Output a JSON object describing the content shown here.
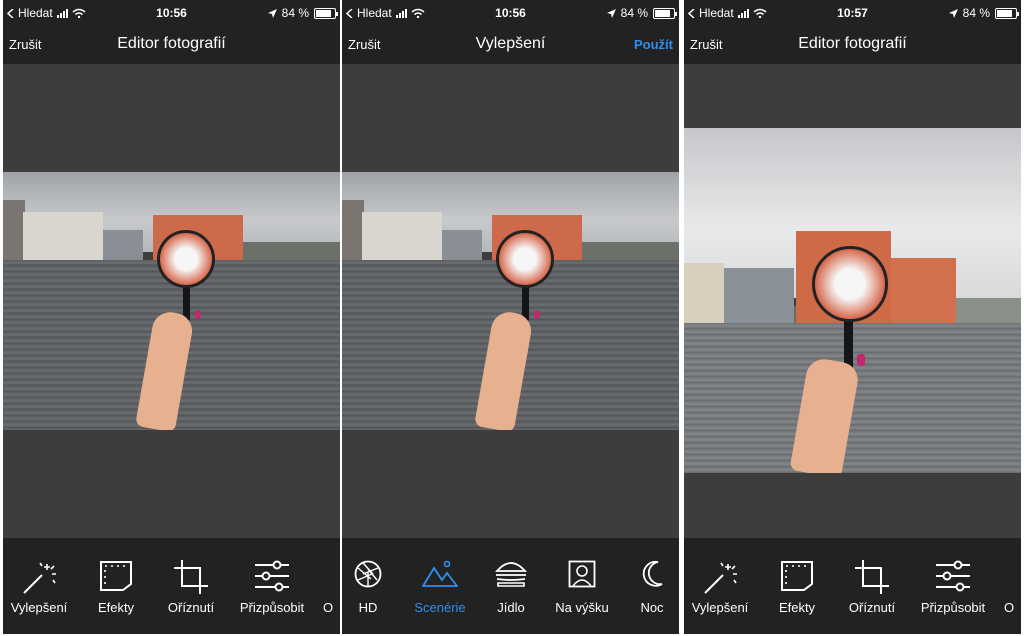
{
  "screens": [
    {
      "status": {
        "carrier": "Hledat",
        "time": "10:56",
        "battery": "84 %"
      },
      "nav": {
        "left": "Zrušit",
        "title": "Editor fotografií",
        "right": ""
      },
      "tools": [
        {
          "icon": "magic-wand-icon",
          "label": "Vylepšení"
        },
        {
          "icon": "film-frame-icon",
          "label": "Efekty"
        },
        {
          "icon": "crop-icon",
          "label": "Oříznutí"
        },
        {
          "icon": "sliders-icon",
          "label": "Přizpůsobit"
        },
        {
          "icon": "",
          "label": "O"
        }
      ]
    },
    {
      "status": {
        "carrier": "Hledat",
        "time": "10:56",
        "battery": "84 %"
      },
      "nav": {
        "left": "Zrušit",
        "title": "Vylepšení",
        "right": "Použít"
      },
      "tools": [
        {
          "icon": "aperture-icon",
          "label": "HD"
        },
        {
          "icon": "mountains-icon",
          "label": "Scenérie",
          "active": true
        },
        {
          "icon": "burger-icon",
          "label": "Jídlo"
        },
        {
          "icon": "portrait-icon",
          "label": "Na výšku"
        },
        {
          "icon": "moon-icon",
          "label": "Noc"
        }
      ]
    },
    {
      "status": {
        "carrier": "Hledat",
        "time": "10:57",
        "battery": "84 %"
      },
      "nav": {
        "left": "Zrušit",
        "title": "Editor fotografií",
        "right": ""
      },
      "tools": [
        {
          "icon": "magic-wand-icon",
          "label": "Vylepšení"
        },
        {
          "icon": "film-frame-icon",
          "label": "Efekty"
        },
        {
          "icon": "crop-icon",
          "label": "Oříznutí"
        },
        {
          "icon": "sliders-icon",
          "label": "Přizpůsobit"
        },
        {
          "icon": "",
          "label": "O"
        }
      ]
    }
  ],
  "colors": {
    "accent": "#2f8ef2",
    "bar": "#222222",
    "canvas": "#3d3d3d",
    "nail": "#c0286e"
  }
}
